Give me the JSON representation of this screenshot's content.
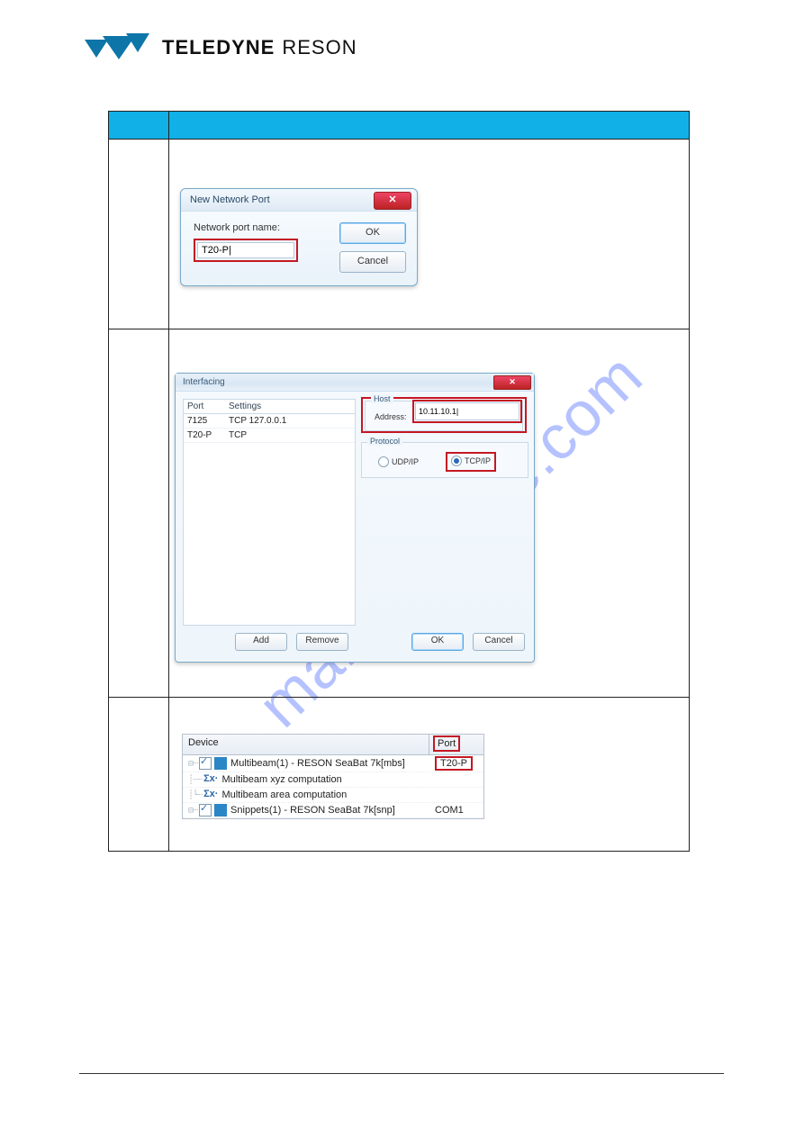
{
  "brand": {
    "bold": "TELEDYNE",
    "light": "RESON"
  },
  "watermark": "manualshive.com",
  "dlg1": {
    "title": "New Network Port",
    "label": "Network port name:",
    "value": "T20-P|",
    "ok": "OK",
    "cancel": "Cancel"
  },
  "dlg2": {
    "title": "Interfacing",
    "cols": {
      "port": "Port",
      "settings": "Settings"
    },
    "rows": [
      {
        "port": "7125",
        "settings": "TCP 127.0.0.1"
      },
      {
        "port": "T20-P",
        "settings": "TCP"
      }
    ],
    "host_legend": "Host",
    "addr_label": "Address:",
    "addr_value": "10.11.10.1|",
    "proto_legend": "Protocol",
    "udp": "UDP/IP",
    "tcp": "TCP/IP",
    "add": "Add",
    "remove": "Remove",
    "ok": "OK",
    "cancel": "Cancel"
  },
  "panel3": {
    "h1": "Device",
    "h2": "Port",
    "rows": [
      {
        "prefix": "⊟┈",
        "cb": true,
        "icon": "device",
        "text": "Multibeam(1) - RESON SeaBat 7k[mbs]",
        "port": "T20-P",
        "hlPort": true
      },
      {
        "prefix": "┊┈┈",
        "sigma": "Σx·",
        "text": "Multibeam xyz computation",
        "port": ""
      },
      {
        "prefix": "┊└┈",
        "sigma": "Σx·",
        "text": "Multibeam area computation",
        "port": ""
      },
      {
        "prefix": "⊟┈",
        "cb": true,
        "icon": "device",
        "text": "Snippets(1) - RESON SeaBat 7k[snp]",
        "port": "COM1"
      }
    ]
  }
}
